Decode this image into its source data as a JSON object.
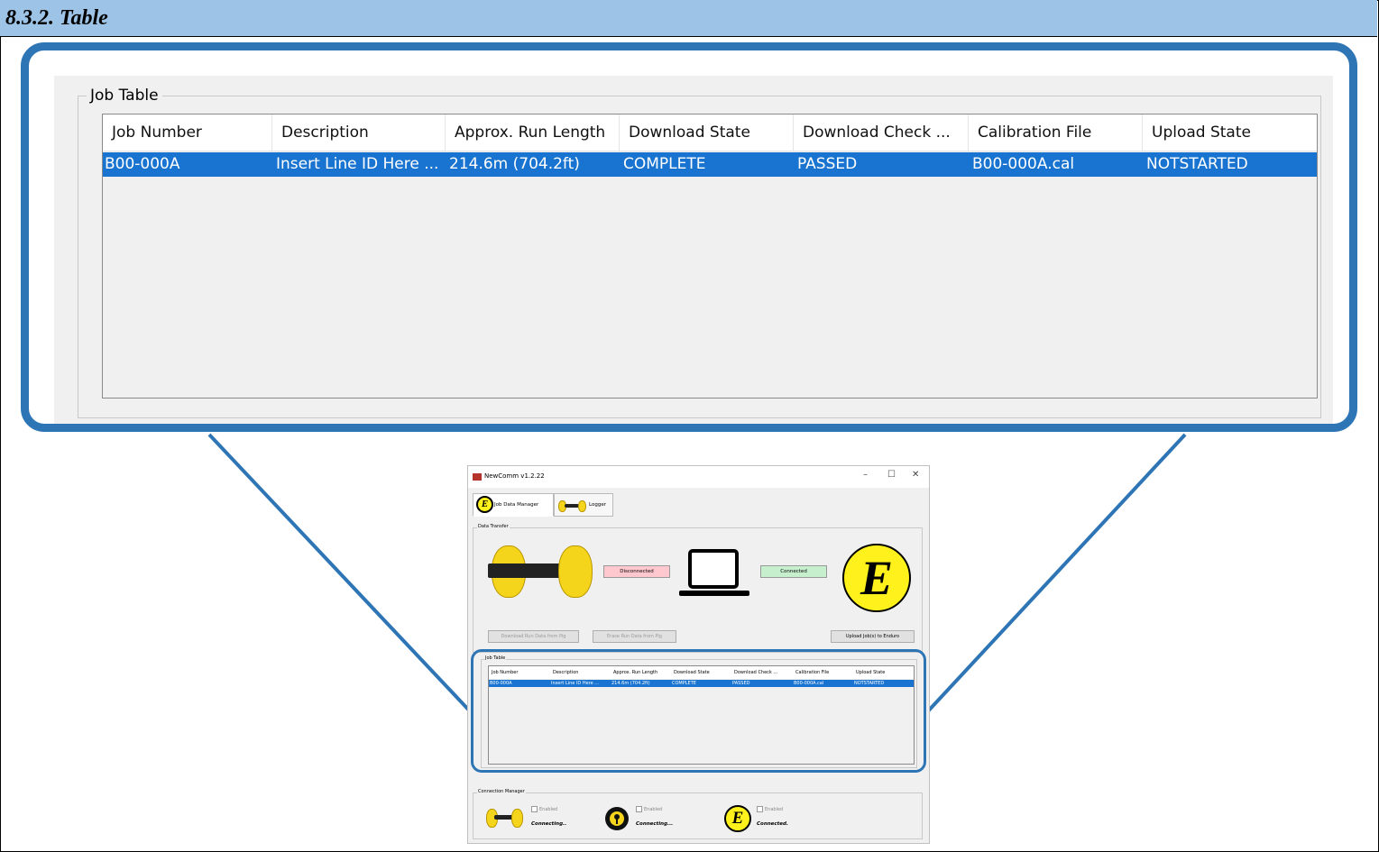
{
  "section_title": "8.3.2. Table",
  "zoom": {
    "group_label": "Job Table",
    "columns": [
      "Job Number",
      "Description",
      "Approx. Run Length",
      "Download State",
      "Download Check ...",
      "Calibration File",
      "Upload State"
    ],
    "row": [
      "B00-000A",
      "Insert Line ID Here ...",
      "214.6m (704.2ft)",
      "COMPLETE",
      "PASSED",
      "B00-000A.cal",
      "NOTSTARTED"
    ]
  },
  "app": {
    "title": "NewComm v1.2.22",
    "window_controls": [
      "–",
      "☐",
      "✕"
    ],
    "tabs": [
      "Job Data Manager",
      "Logger"
    ],
    "data_transfer": {
      "label": "Data Transfer",
      "pig_status": "Disconnected",
      "enduro_status": "Connected",
      "logo_letter": "E",
      "buttons": [
        "Download Run Data from Pig",
        "Erase Run Data from Pig",
        "Upload Job(s) to Enduro"
      ]
    },
    "job_table": {
      "label": "Job Table",
      "columns": [
        "Job Number",
        "Description",
        "Approx. Run Length",
        "Download State",
        "Download Check ...",
        "Calibration File",
        "Upload State"
      ],
      "row": [
        "B00-000A",
        "Insert Line ID Here ...",
        "214.6m (704.2ft)",
        "COMPLETE",
        "PASSED",
        "B00-000A.cal",
        "NOTSTARTED"
      ]
    },
    "connection_manager": {
      "label": "Connection Manager",
      "items": [
        {
          "checkbox": "Enabled",
          "status": "Connecting.."
        },
        {
          "checkbox": "Enabled",
          "status": "Connecting..."
        },
        {
          "checkbox": "Enabled",
          "status": "Connected."
        }
      ]
    }
  },
  "colors": {
    "header_bg": "#9dc3e6",
    "callout_blue": "#2e75b6",
    "selection_blue": "#1874d0"
  }
}
